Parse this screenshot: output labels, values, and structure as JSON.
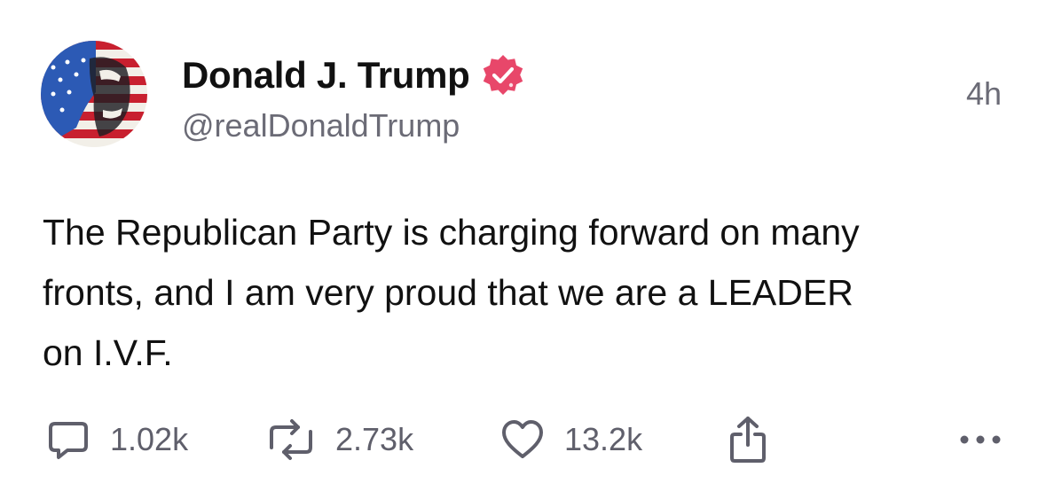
{
  "post": {
    "author": {
      "display_name": "Donald J. Trump",
      "handle": "@realDonaldTrump",
      "verified": true,
      "avatar_icon": "avatar-flag-portrait"
    },
    "timestamp": "4h",
    "text": "The Republican Party is charging forward on many\nfronts, and I am very proud that we are a LEADER\non I.V.F.",
    "actions": {
      "replies": {
        "icon": "comment-icon",
        "count": "1.02k"
      },
      "reposts": {
        "icon": "repost-icon",
        "count": "2.73k"
      },
      "likes": {
        "icon": "heart-icon",
        "count": "13.2k"
      },
      "share": {
        "icon": "share-icon"
      },
      "more": {
        "icon": "more-icon"
      }
    }
  },
  "colors": {
    "text": "#111111",
    "muted": "#6b6b76",
    "icon": "#5f5f6b",
    "verified_badge": "#e8476a",
    "background": "#ffffff"
  }
}
